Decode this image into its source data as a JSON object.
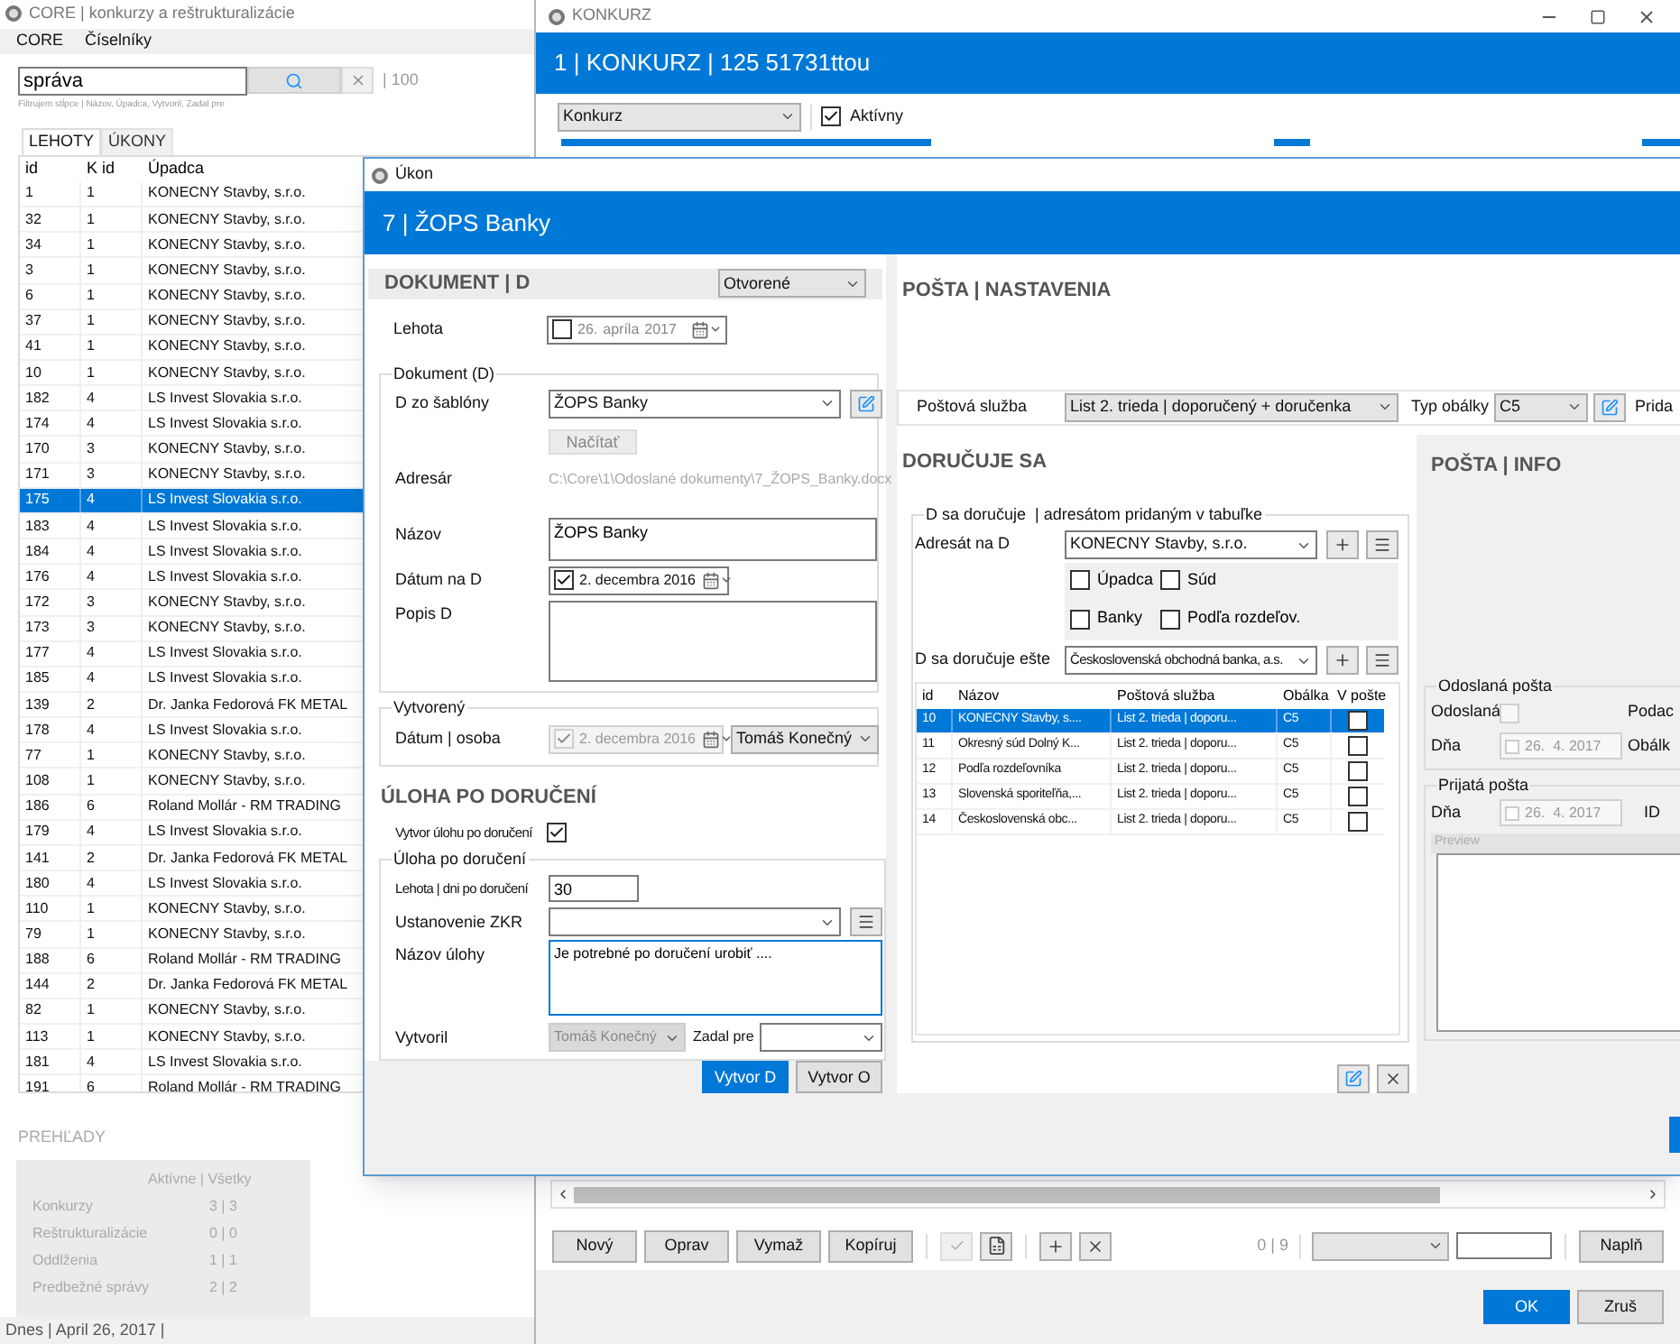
{
  "main_window": {
    "title": "CORE | konkurzy a reštrukturalizácie",
    "menu": [
      "CORE",
      "Číselníky"
    ],
    "search": {
      "value": "správa"
    },
    "count": "| 100",
    "filter_hint": "Filtrujem stĺpce | Názov, Úpadca, Vytvoril, Zadal pre",
    "tabs": [
      {
        "label": "LEHOTY",
        "selected": true
      },
      {
        "label": "ÚKONY",
        "selected": false
      }
    ],
    "table": {
      "columns": [
        "id",
        "K id",
        "Úpadca"
      ],
      "rows": [
        {
          "cells": [
            "1",
            "1",
            "KONECNY Stavby, s.r.o."
          ],
          "selected": false
        },
        {
          "cells": [
            "32",
            "1",
            "KONECNY Stavby, s.r.o."
          ],
          "selected": false
        },
        {
          "cells": [
            "34",
            "1",
            "KONECNY Stavby, s.r.o."
          ],
          "selected": false
        },
        {
          "cells": [
            "3",
            "1",
            "KONECNY Stavby, s.r.o."
          ],
          "selected": false
        },
        {
          "cells": [
            "6",
            "1",
            "KONECNY Stavby, s.r.o."
          ],
          "selected": false
        },
        {
          "cells": [
            "37",
            "1",
            "KONECNY Stavby, s.r.o."
          ],
          "selected": false
        },
        {
          "cells": [
            "41",
            "1",
            "KONECNY Stavby, s.r.o."
          ],
          "selected": false
        },
        {
          "cells": [
            "10",
            "1",
            "KONECNY Stavby, s.r.o."
          ],
          "selected": false
        },
        {
          "cells": [
            "182",
            "4",
            "LS Invest Slovakia s.r.o."
          ],
          "selected": false
        },
        {
          "cells": [
            "174",
            "4",
            "LS Invest Slovakia s.r.o."
          ],
          "selected": false
        },
        {
          "cells": [
            "170",
            "3",
            "KONECNY Stavby, s.r.o."
          ],
          "selected": false
        },
        {
          "cells": [
            "171",
            "3",
            "KONECNY Stavby, s.r.o."
          ],
          "selected": false
        },
        {
          "cells": [
            "175",
            "4",
            "LS Invest Slovakia s.r.o."
          ],
          "selected": true
        },
        {
          "cells": [
            "183",
            "4",
            "LS Invest Slovakia s.r.o."
          ],
          "selected": false
        },
        {
          "cells": [
            "184",
            "4",
            "LS Invest Slovakia s.r.o."
          ],
          "selected": false
        },
        {
          "cells": [
            "176",
            "4",
            "LS Invest Slovakia s.r.o."
          ],
          "selected": false
        },
        {
          "cells": [
            "172",
            "3",
            "KONECNY Stavby, s.r.o."
          ],
          "selected": false
        },
        {
          "cells": [
            "173",
            "3",
            "KONECNY Stavby, s.r.o."
          ],
          "selected": false
        },
        {
          "cells": [
            "177",
            "4",
            "LS Invest Slovakia s.r.o."
          ],
          "selected": false
        },
        {
          "cells": [
            "185",
            "4",
            "LS Invest Slovakia s.r.o."
          ],
          "selected": false
        },
        {
          "cells": [
            "139",
            "2",
            "Dr. Janka Fedorová FK METAL"
          ],
          "selected": false
        },
        {
          "cells": [
            "178",
            "4",
            "LS Invest Slovakia s.r.o."
          ],
          "selected": false
        },
        {
          "cells": [
            "77",
            "1",
            "KONECNY Stavby, s.r.o."
          ],
          "selected": false
        },
        {
          "cells": [
            "108",
            "1",
            "KONECNY Stavby, s.r.o."
          ],
          "selected": false
        },
        {
          "cells": [
            "186",
            "6",
            "Roland Mollár - RM TRADING"
          ],
          "selected": false
        },
        {
          "cells": [
            "179",
            "4",
            "LS Invest Slovakia s.r.o."
          ],
          "selected": false
        },
        {
          "cells": [
            "141",
            "2",
            "Dr. Janka Fedorová FK METAL"
          ],
          "selected": false
        },
        {
          "cells": [
            "180",
            "4",
            "LS Invest Slovakia s.r.o."
          ],
          "selected": false
        },
        {
          "cells": [
            "110",
            "1",
            "KONECNY Stavby, s.r.o."
          ],
          "selected": false
        },
        {
          "cells": [
            "79",
            "1",
            "KONECNY Stavby, s.r.o."
          ],
          "selected": false
        },
        {
          "cells": [
            "188",
            "6",
            "Roland Mollár - RM TRADING"
          ],
          "selected": false
        },
        {
          "cells": [
            "144",
            "2",
            "Dr. Janka Fedorová FK METAL"
          ],
          "selected": false
        },
        {
          "cells": [
            "82",
            "1",
            "KONECNY Stavby, s.r.o."
          ],
          "selected": false
        },
        {
          "cells": [
            "113",
            "1",
            "KONECNY Stavby, s.r.o."
          ],
          "selected": false
        },
        {
          "cells": [
            "181",
            "4",
            "LS Invest Slovakia s.r.o."
          ],
          "selected": false
        },
        {
          "cells": [
            "191",
            "6",
            "Roland Mollár - RM TRADING"
          ],
          "selected": false
        }
      ]
    },
    "overview": {
      "title": "PREHĽADY",
      "header": "Aktívne | Všetky",
      "rows": [
        {
          "label": "Konkurzy",
          "value": "3 | 3"
        },
        {
          "label": "Reštrukturalizácie",
          "value": "0 | 0"
        },
        {
          "label": "Oddlženia",
          "value": "1 | 1"
        },
        {
          "label": "Predbežné správy",
          "value": "2 | 2"
        }
      ]
    },
    "status_bar": "Dnes | April 26, 2017 |"
  },
  "konkurz_window": {
    "title": "KONKURZ",
    "header": "1 | KONKURZ | 125 51731ttou",
    "type_select": "Konkurz",
    "active": {
      "label": "Aktívny",
      "checked": true
    },
    "toolbar": {
      "buttons": [
        "Nový",
        "Oprav",
        "Vymaž",
        "Kopíruj"
      ],
      "counter": "0 | 9",
      "fill_button": "Naplň"
    },
    "dialog_buttons": [
      {
        "label": "OK",
        "primary": true
      },
      {
        "label": "Zruš",
        "primary": false
      }
    ]
  },
  "ukon_dialog": {
    "title": "Úkon",
    "header": "7 | ŽOPS Banky",
    "document": {
      "heading": "DOKUMENT | D",
      "state": "Otvorené",
      "deadline": {
        "label": "Lehota",
        "date_parts": [
          "26.",
          "apríla",
          "2017"
        ],
        "checked": false
      },
      "group": "Dokument (D)",
      "template": {
        "label": "D zo šablóny",
        "value": "ŽOPS Banky"
      },
      "load_button": "Načítať",
      "path": {
        "label": "Adresár",
        "value": "C:\\Core\\1\\Odoslané dokumenty\\7_ŽOPS_Banky.docx"
      },
      "name": {
        "label": "Názov",
        "value": "ŽOPS Banky"
      },
      "doc_date": {
        "label": "Dátum na D",
        "value": "2. decembra 2016",
        "checked": true
      },
      "description": {
        "label": "Popis D"
      },
      "created_group": "Vytvorený",
      "created": {
        "label": "Dátum | osoba",
        "date": "2. decembra 2016",
        "checked": true,
        "person": "Tomáš Konečný"
      }
    },
    "task": {
      "heading": "ÚLOHA PO DORUČENÍ",
      "create": {
        "label": "Vytvor úlohu po doručení",
        "checked": true
      },
      "group": "Úloha po doručení",
      "days": {
        "label": "Lehota | dni po doručení",
        "value": "30"
      },
      "provision": {
        "label": "Ustanovenie ZKR"
      },
      "task_name": {
        "label": "Názov úlohy",
        "value": "Je potrebné po doručení urobiť ...."
      },
      "created_by": {
        "label": "Vytvoril",
        "value": "Tomáš Konečný"
      },
      "assigned": {
        "label": "Zadal pre"
      }
    },
    "buttons": [
      {
        "label": "Vytvor D",
        "primary": true
      },
      {
        "label": "Vytvor O",
        "primary": false
      }
    ],
    "mail_settings": {
      "heading": "POŠTA | NASTAVENIA",
      "service": {
        "label": "Poštová služba",
        "value": "List 2. trieda | doporučený + doručenka"
      },
      "envelope": {
        "label": "Typ obálky",
        "value": "C5"
      },
      "cut_label": "Prida"
    },
    "delivery": {
      "heading": "DORUČUJE SA",
      "group": "D sa doručuje  | adresátom pridaným v tabuľke",
      "addressee": {
        "label": "Adresát na D",
        "value": "KONECNY Stavby, s.r.o."
      },
      "options": [
        {
          "label": "Úpadca",
          "checked": false
        },
        {
          "label": "Súd",
          "checked": false
        },
        {
          "label": "Banky",
          "checked": false
        },
        {
          "label": "Podľa rozdeľov.",
          "checked": false
        }
      ],
      "also": {
        "label": "D sa doručuje ešte",
        "value": "Československá obchodná banka, a.s."
      },
      "table": {
        "columns": [
          "id",
          "Názov",
          "Poštová služba",
          "Obálka",
          "V pošte"
        ],
        "rows": [
          {
            "cells": [
              "10",
              "KONECNY Stavby, s....",
              "List 2. trieda | doporu...",
              "C5"
            ],
            "in_post": false,
            "selected": true
          },
          {
            "cells": [
              "11",
              "Okresný súd Dolný K...",
              "List 2. trieda | doporu...",
              "C5"
            ],
            "in_post": false,
            "selected": false
          },
          {
            "cells": [
              "12",
              "Podľa rozdeľovníka",
              "List 2. trieda | doporu...",
              "C5"
            ],
            "in_post": false,
            "selected": false
          },
          {
            "cells": [
              "13",
              "Slovenská sporiteľňa,...",
              "List 2. trieda | doporu...",
              "C5"
            ],
            "in_post": false,
            "selected": false
          },
          {
            "cells": [
              "14",
              "Československá obc...",
              "List 2. trieda | doporu...",
              "C5"
            ],
            "in_post": false,
            "selected": false
          }
        ]
      }
    },
    "info": {
      "heading": "POŠTA | INFO",
      "sent_group": "Odoslaná pošta",
      "sent": {
        "label": "Odoslaná",
        "checked": false
      },
      "sent_cut": "Podac",
      "sent_day": {
        "label": "Dňa",
        "date": "26.  4. 2017"
      },
      "envelope_cut": "Obálk",
      "received_group": "Prijatá pošta",
      "received_day": {
        "label": "Dňa",
        "date": "26.  4. 2017"
      },
      "id_label": "ID",
      "preview": "Preview"
    }
  }
}
